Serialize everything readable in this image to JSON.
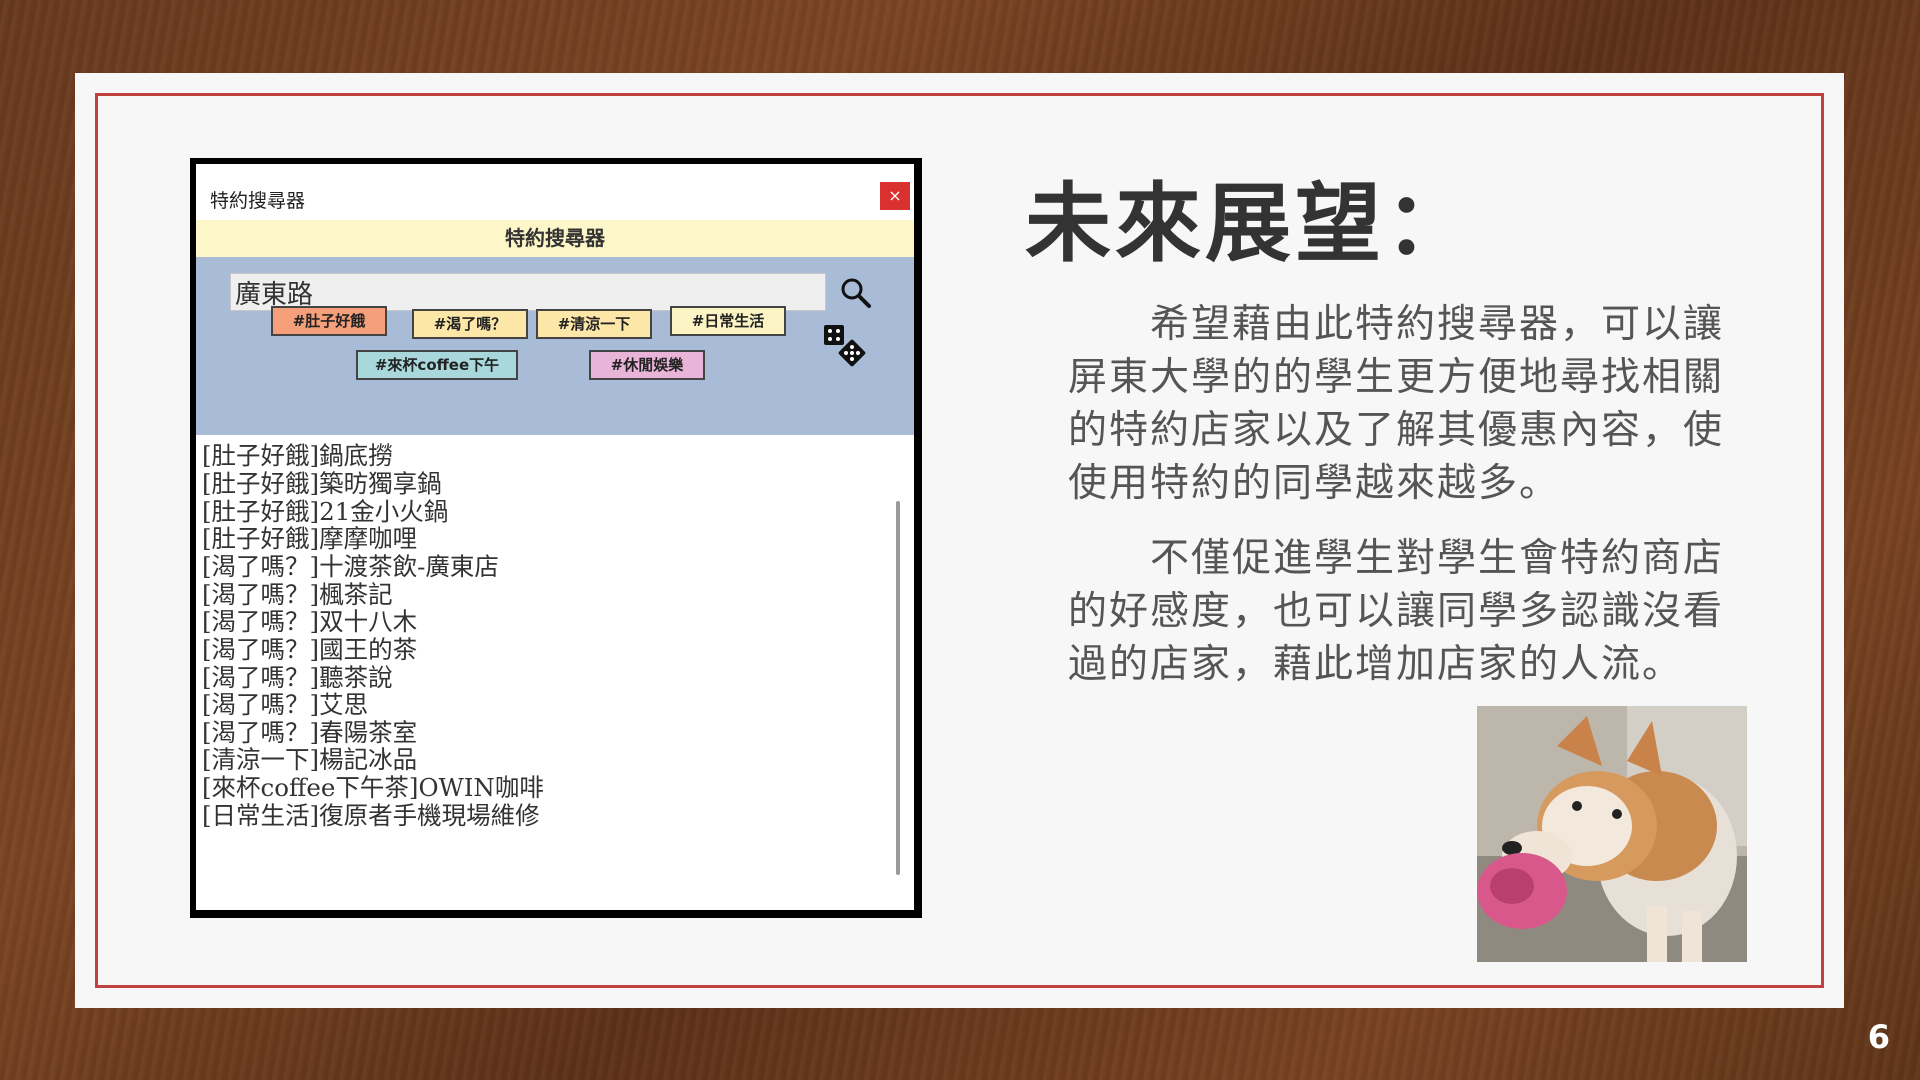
{
  "app": {
    "title": "特約搜尋器",
    "header": "特約搜尋器",
    "close_label": "×",
    "search": {
      "value": "廣東路",
      "placeholder": ""
    },
    "tags": [
      "#肚子好餓",
      "#渴了嗎？",
      "#清涼一下",
      "#日常生活",
      "#來杯coffee下午",
      "#休閒娛樂"
    ],
    "results": [
      "[肚子好餓]鍋底撈",
      "[肚子好餓]築昉獨享鍋",
      "[肚子好餓]21金小火鍋",
      "[肚子好餓]摩摩咖哩",
      "[渴了嗎？]十渡茶飲-廣東店",
      "[渴了嗎？]楓茶記",
      "[渴了嗎？]双十八木",
      "[渴了嗎？]國王的茶",
      "[渴了嗎？]聽茶說",
      "[渴了嗎？]艾思",
      "[渴了嗎？]春陽茶室",
      "[清涼一下]楊記冰品",
      "[來杯coffee下午茶]OWIN咖啡",
      "[日常生活]復原者手機現場維修"
    ]
  },
  "slide": {
    "heading": "未來展望：",
    "paragraph1": "　　希望藉由此特約搜尋器，可以讓屏東大學的的學生更方便地尋找相關的特約店家以及了解其優惠內容，使使用特約的同學越來越多。",
    "paragraph2": "　　不僅促進學生對學生會特約商店的好感度，也可以讓同學多認識沒看過的店家，藉此增加店家的人流。",
    "page_number": "6"
  },
  "colors": {
    "border": "#c0413f",
    "header_bg": "#fdf6c8",
    "panel_bg": "#a8bcd8",
    "tag_colors": [
      "#f5a07a",
      "#fce7a8",
      "#fce7a8",
      "#fcf4c4",
      "#a8d8dc",
      "#e8b4d8"
    ]
  }
}
